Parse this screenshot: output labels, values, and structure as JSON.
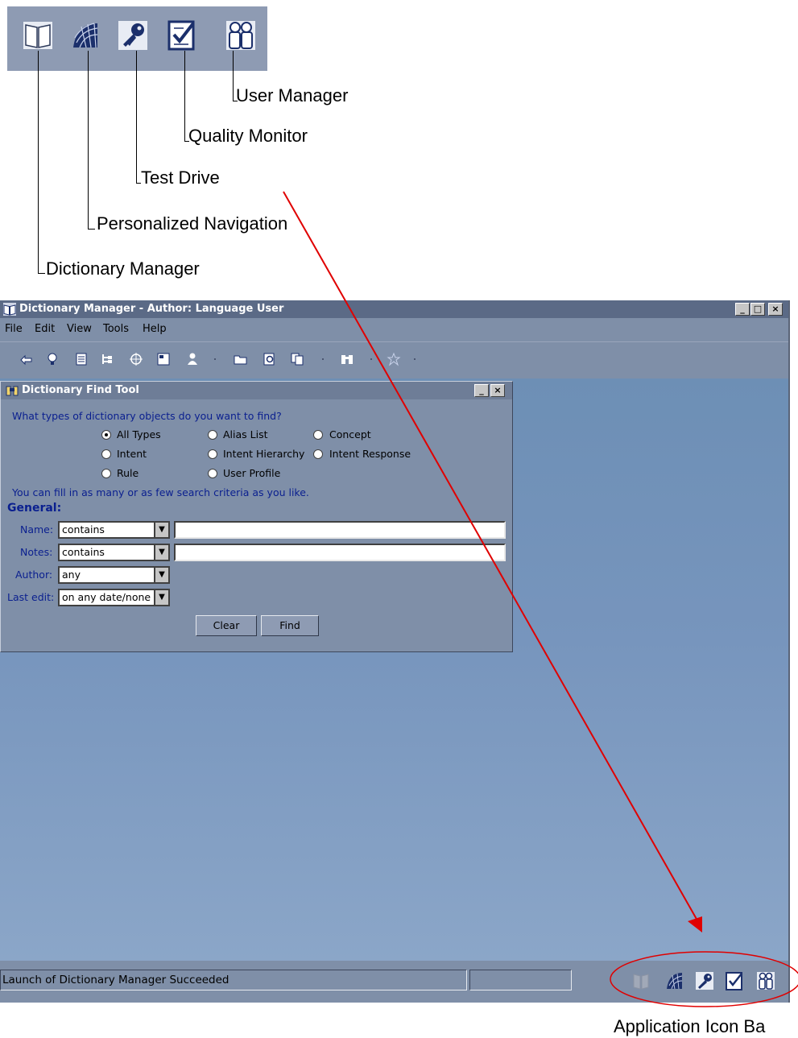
{
  "callouts": {
    "user_manager": "User Manager",
    "quality_monitor": "Quality Monitor",
    "test_drive": "Test Drive",
    "personalized_navigation": "Personalized Navigation",
    "dictionary_manager": "Dictionary Manager",
    "application_icon_bar": "Application Icon Ba"
  },
  "window": {
    "title": "Dictionary Manager - Author: Language User",
    "minimize": "_",
    "maximize": "□",
    "close": "×",
    "menu": [
      "File",
      "Edit",
      "View",
      "Tools",
      "Help"
    ]
  },
  "toolbar_icons": [
    "back-icon",
    "bulb-icon",
    "list-icon",
    "tree-icon",
    "target-icon",
    "form-icon",
    "user-icon",
    "open-folder-icon",
    "search-doc-icon",
    "copy-icon",
    "binoculars-icon",
    "star-network-icon"
  ],
  "find_tool": {
    "title": "Dictionary Find Tool",
    "question": "What types of dictionary objects do you want to find?",
    "types": [
      {
        "label": "All Types",
        "selected": true
      },
      {
        "label": "Alias List",
        "selected": false
      },
      {
        "label": "Concept",
        "selected": false
      },
      {
        "label": "Intent",
        "selected": false
      },
      {
        "label": "Intent Hierarchy",
        "selected": false
      },
      {
        "label": "Intent Response",
        "selected": false
      },
      {
        "label": "Rule",
        "selected": false
      },
      {
        "label": "User Profile",
        "selected": false
      }
    ],
    "hint": "You can fill in as many or as few search criteria as you like.",
    "section": "General:",
    "fields": {
      "name_label": "Name:",
      "name_op": "contains",
      "name_value": "",
      "notes_label": "Notes:",
      "notes_op": "contains",
      "notes_value": "",
      "author_label": "Author:",
      "author_value": "any",
      "lastedit_label": "Last edit:",
      "lastedit_value": "on any date/none"
    },
    "clear_button": "Clear",
    "find_button": "Find"
  },
  "status": {
    "message": "Launch of Dictionary Manager Succeeded",
    "secondary": ""
  },
  "colors": {
    "arrow": "#e00000",
    "titlebar": "#5b6a86",
    "desktop": "#7795bd",
    "label_blue": "#0a1f8f"
  }
}
